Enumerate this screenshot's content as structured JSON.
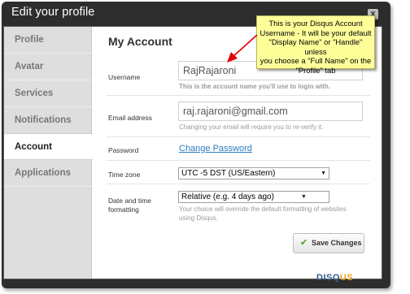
{
  "dialog": {
    "title": "Edit your profile",
    "close_label": "x"
  },
  "sidebar": {
    "items": [
      {
        "label": "Profile"
      },
      {
        "label": "Avatar"
      },
      {
        "label": "Services"
      },
      {
        "label": "Notifications"
      },
      {
        "label": "Account",
        "active": true
      },
      {
        "label": "Applications"
      }
    ]
  },
  "account": {
    "heading": "My Account",
    "username": {
      "label": "Username",
      "value": "RajRajaroni",
      "hint": "This is the account name you'll use to login with."
    },
    "email": {
      "label": "Email address",
      "value": "raj.rajaroni@gmail.com",
      "hint": "Changing your email will require you to re-verify it."
    },
    "password": {
      "label": "Password",
      "link": "Change Password"
    },
    "timezone": {
      "label": "Time zone",
      "selected": "UTC -5 DST (US/Eastern)"
    },
    "datetime": {
      "label_line1": "Date and time",
      "label_line2": "formatting",
      "selected": "Relative (e.g. 4 days ago)",
      "hint_line1": "Your choice will override the default formatting of websites",
      "hint_line2": "using Disqus."
    },
    "save_label": "Save Changes"
  },
  "brand": {
    "part1": "DISQ",
    "part2": "US"
  },
  "tooltip": {
    "line1": "This is your Disqus Account",
    "line2": "Username - It will be your default",
    "line3": "\"Display Name\" or \"Handle\" unless",
    "line4": "you choose a \"Full Name\" on the",
    "line5": "\"Profile\" tab"
  },
  "colors": {
    "dialog_bg": "#2d2d2d",
    "sidebar_bg": "#dedede",
    "link": "#2a7bbf",
    "tooltip_bg": "#ffff9a",
    "arrow": "#e00000",
    "brand": "#2d5c8c",
    "brand_accent": "#e8a317"
  },
  "icons": {
    "close": "close-icon",
    "save": "checkmark-icon",
    "select": "chevron-down-icon"
  }
}
